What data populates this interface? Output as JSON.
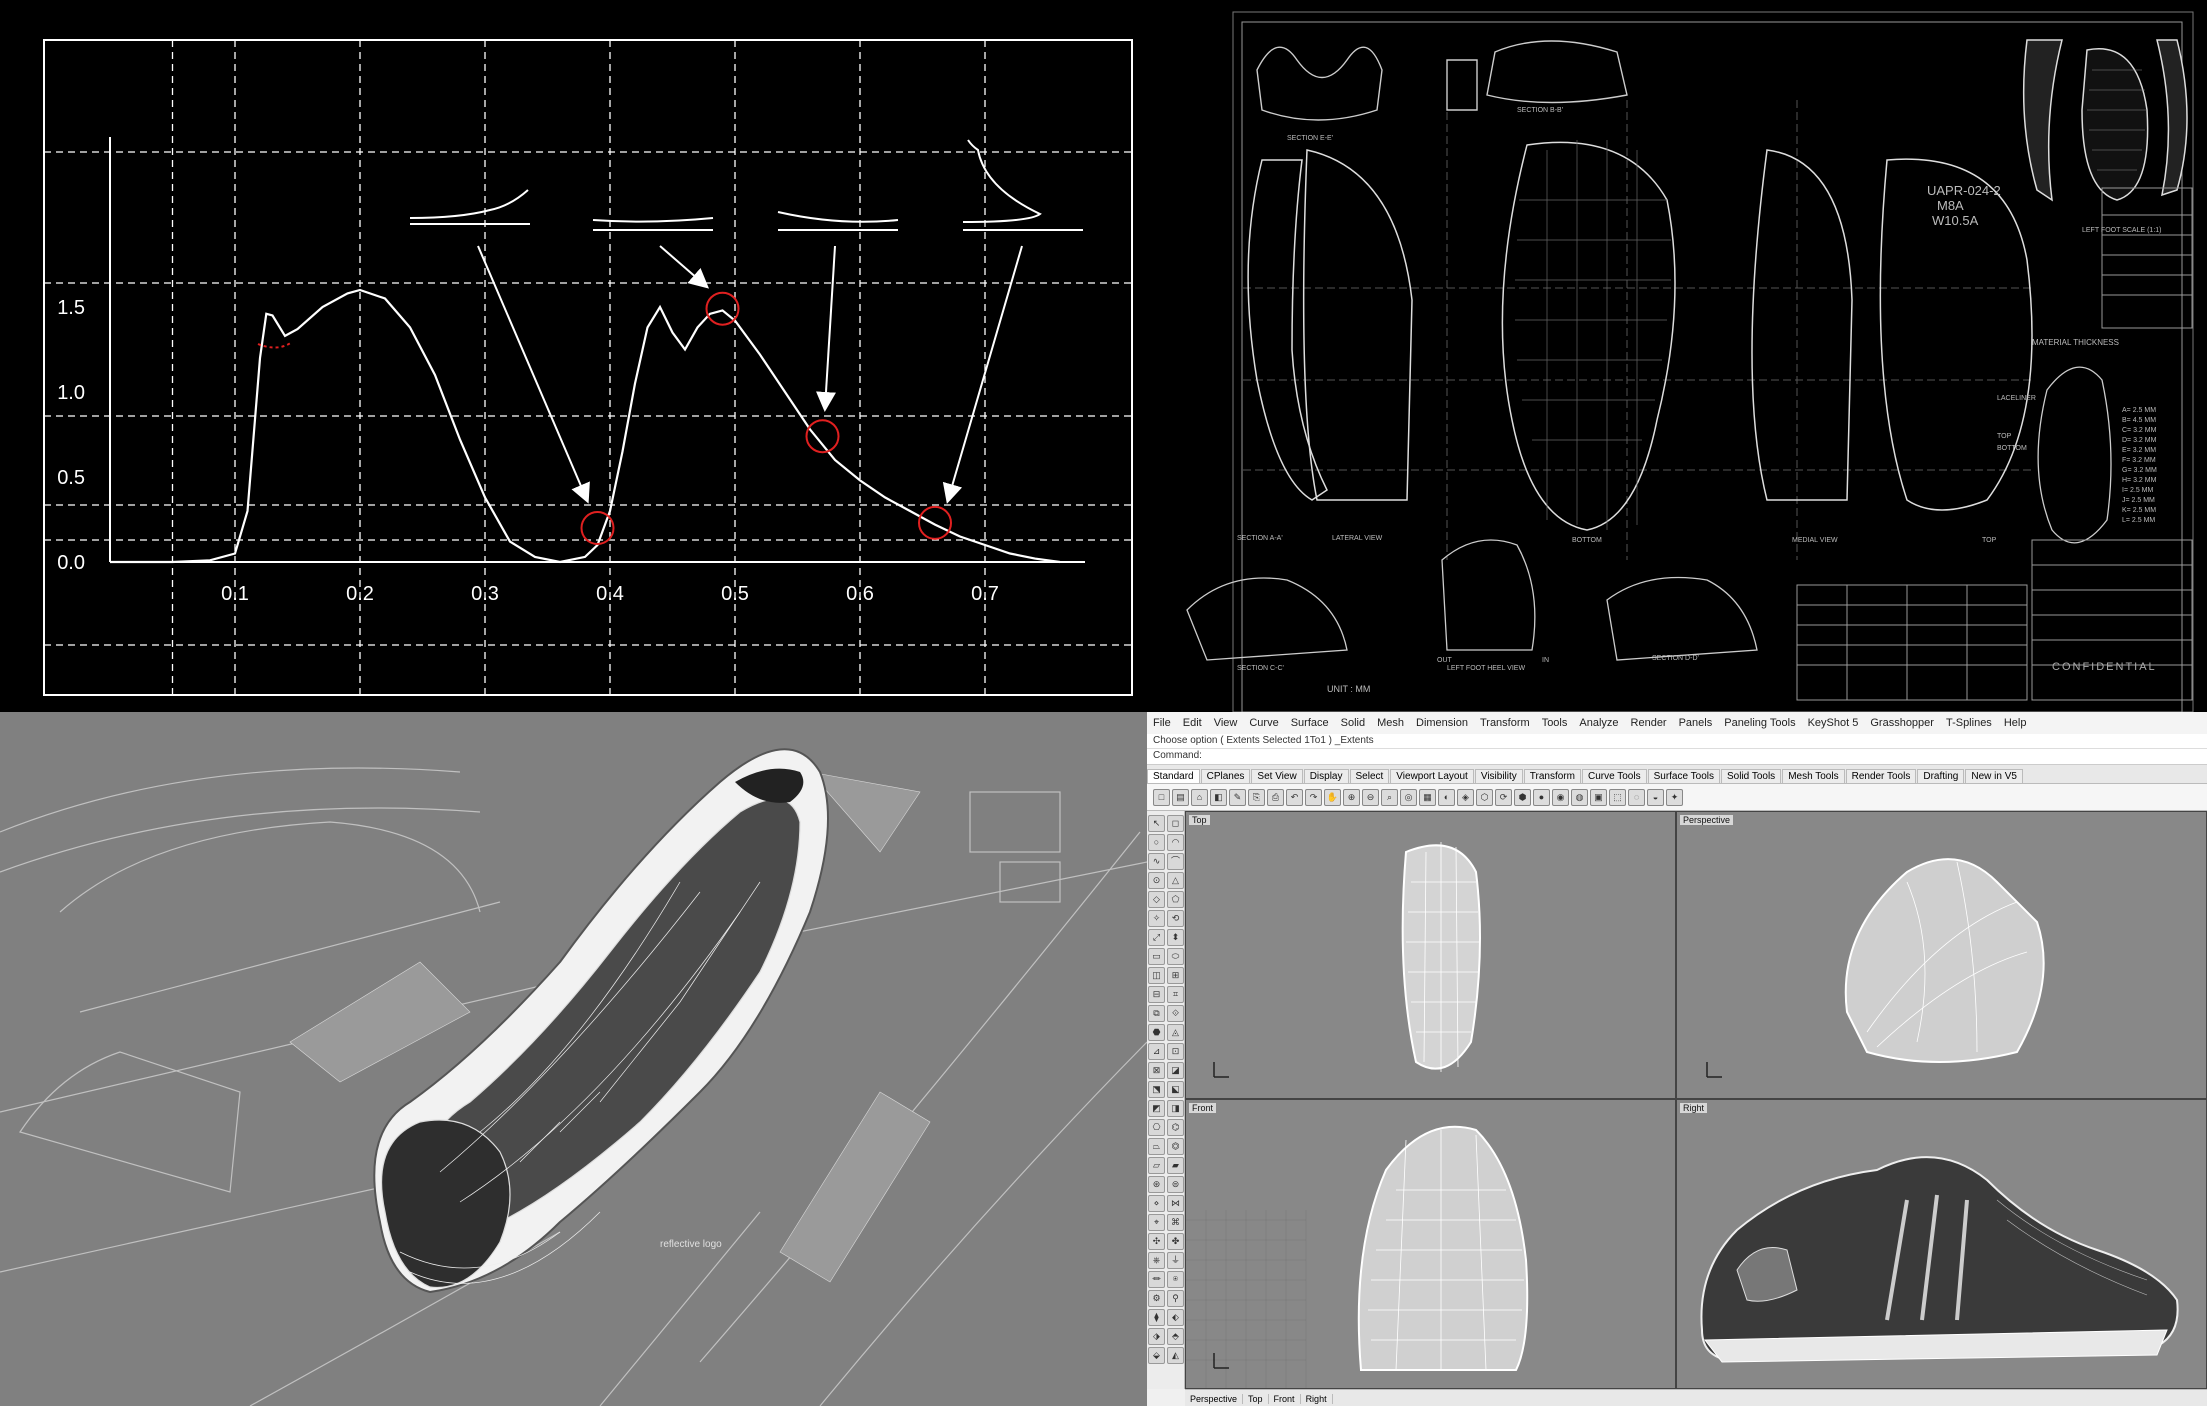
{
  "chart_data": {
    "type": "line",
    "x_ticks": [
      "0.1",
      "0.2",
      "0.3",
      "0.4",
      "0.5",
      "0.6",
      "0.7"
    ],
    "y_ticks": [
      "0.0",
      "0.5",
      "1.0",
      "1.5"
    ],
    "xlim": [
      0.0,
      0.78
    ],
    "ylim": [
      0.0,
      2.5
    ],
    "grid": true,
    "series": [
      {
        "x": [
          0.0,
          0.05,
          0.08,
          0.1,
          0.11,
          0.12,
          0.125,
          0.13,
          0.14,
          0.15,
          0.17,
          0.19,
          0.2,
          0.22,
          0.24,
          0.26,
          0.28,
          0.3,
          0.32,
          0.34,
          0.36,
          0.38,
          0.39,
          0.4,
          0.41,
          0.42,
          0.43,
          0.44,
          0.45,
          0.46,
          0.47,
          0.48,
          0.49,
          0.5,
          0.52,
          0.54,
          0.56,
          0.58,
          0.6,
          0.62,
          0.64,
          0.66,
          0.68,
          0.7,
          0.72,
          0.74,
          0.76
        ],
        "y": [
          0.0,
          0.0,
          0.01,
          0.05,
          0.3,
          1.2,
          1.46,
          1.45,
          1.33,
          1.37,
          1.5,
          1.58,
          1.6,
          1.55,
          1.38,
          1.1,
          0.72,
          0.38,
          0.12,
          0.03,
          0.0,
          0.03,
          0.1,
          0.3,
          0.65,
          1.05,
          1.38,
          1.5,
          1.35,
          1.25,
          1.38,
          1.46,
          1.48,
          1.42,
          1.22,
          1.0,
          0.78,
          0.6,
          0.48,
          0.38,
          0.3,
          0.22,
          0.15,
          0.1,
          0.05,
          0.02,
          0.0
        ]
      }
    ],
    "markers": [
      {
        "x": 0.39,
        "y": 0.2
      },
      {
        "x": 0.49,
        "y": 1.49
      },
      {
        "x": 0.57,
        "y": 0.74
      },
      {
        "x": 0.66,
        "y": 0.23
      }
    ]
  },
  "drawing": {
    "title_block_text": "CONFIDENTIAL",
    "unit_label": "UNIT : MM",
    "material_title": "MATERIAL THICKNESS",
    "thickness_list": [
      "A= 2.5 MM",
      "B= 4.5 MM",
      "C= 3.2 MM",
      "D= 3.2 MM",
      "E= 3.2 MM",
      "F= 3.2 MM",
      "G= 3.2 MM",
      "H= 3.2 MM",
      "I= 2.5 MM",
      "J= 2.5 MM",
      "K= 2.5 MM",
      "L= 2.5 MM"
    ],
    "labels": {
      "section_ee": "SECTION E-E'",
      "section_bb": "SECTION B-B'",
      "section_aa": "SECTION A-A'",
      "section_cc": "SECTION C-C'",
      "section_dd": "SECTION D-D'",
      "lateral_view": "LATERAL VIEW",
      "medial_view": "MEDIAL VIEW",
      "bottom": "BOTTOM",
      "top": "TOP",
      "heel_view": "LEFT FOOT HEEL VIEW",
      "left_foot_scale": "LEFT FOOT SCALE (1:1)",
      "model_code": "UAPR-024-2",
      "model_size": "M8A",
      "model_w": "W10.5A",
      "laceliner": "LACELINER",
      "bottom_side": "BOTTOM",
      "top_side": "TOP",
      "out": "OUT",
      "in": "IN"
    }
  },
  "render": {
    "labels": {
      "reflective": "reflective logo"
    }
  },
  "app": {
    "menu": [
      "File",
      "Edit",
      "View",
      "Curve",
      "Surface",
      "Solid",
      "Mesh",
      "Dimension",
      "Transform",
      "Tools",
      "Analyze",
      "Render",
      "Panels",
      "Paneling Tools",
      "KeyShot 5",
      "Grasshopper",
      "T-Splines",
      "Help"
    ],
    "command_history": "Choose option ( Extents Selected 1To1 ) _Extents",
    "command_prompt": "Command:",
    "tabs": [
      "Standard",
      "CPlanes",
      "Set View",
      "Display",
      "Select",
      "Viewport Layout",
      "Visibility",
      "Transform",
      "Curve Tools",
      "Surface Tools",
      "Solid Tools",
      "Mesh Tools",
      "Render Tools",
      "Drafting",
      "New in V5"
    ],
    "active_tab": "Standard",
    "viewports": {
      "top": "Top",
      "perspective": "Perspective",
      "front": "Front",
      "right": "Right"
    },
    "viewport_tabs": [
      "Perspective",
      "Top",
      "Front",
      "Right"
    ]
  }
}
